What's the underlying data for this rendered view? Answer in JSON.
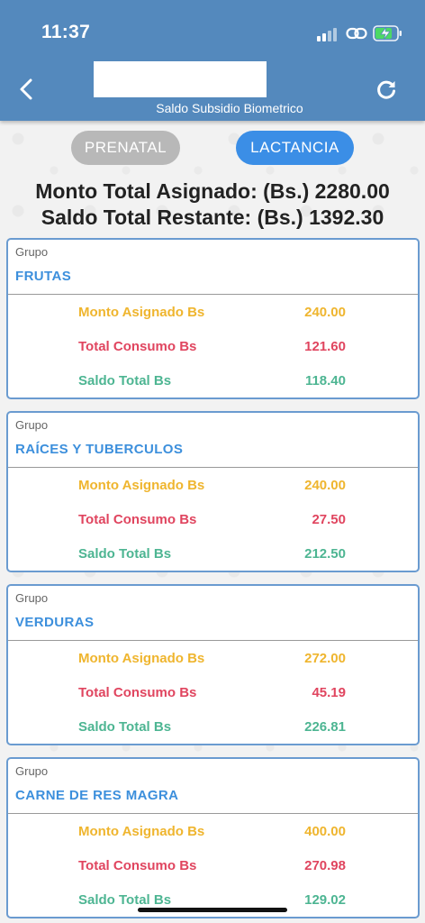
{
  "status_bar": {
    "time": "11:37"
  },
  "header": {
    "subtitle": "Saldo Subsidio Biometrico"
  },
  "tabs": [
    {
      "label": "PRENATAL",
      "active": false
    },
    {
      "label": "LACTANCIA",
      "active": true
    }
  ],
  "totals": {
    "assigned": "Monto Total Asignado: (Bs.) 2280.00",
    "remaining": "Saldo Total Restante: (Bs.) 1392.30"
  },
  "colors": {
    "header": "#5489bd",
    "tab_active": "#3b8ee6",
    "tab_inactive": "#b8b8b8",
    "title_blue": "#3c8fdc",
    "asignado": "#efb52e",
    "consumo": "#e0455f",
    "saldo": "#4db592"
  },
  "cards": [
    {
      "group_label": "Grupo",
      "title": "FRUTAS",
      "rows": [
        {
          "label": "Monto Asignado Bs",
          "value": "240.00"
        },
        {
          "label": "Total Consumo Bs",
          "value": "121.60"
        },
        {
          "label": "Saldo Total Bs",
          "value": "118.40"
        }
      ]
    },
    {
      "group_label": "Grupo",
      "title": "RAÍCES Y TUBERCULOS",
      "rows": [
        {
          "label": "Monto Asignado Bs",
          "value": "240.00"
        },
        {
          "label": "Total Consumo Bs",
          "value": "27.50"
        },
        {
          "label": "Saldo Total Bs",
          "value": "212.50"
        }
      ]
    },
    {
      "group_label": "Grupo",
      "title": "VERDURAS",
      "rows": [
        {
          "label": "Monto Asignado Bs",
          "value": "272.00"
        },
        {
          "label": "Total Consumo Bs",
          "value": "45.19"
        },
        {
          "label": "Saldo Total Bs",
          "value": "226.81"
        }
      ]
    },
    {
      "group_label": "Grupo",
      "title": "CARNE DE RES MAGRA",
      "rows": [
        {
          "label": "Monto Asignado Bs",
          "value": "400.00"
        },
        {
          "label": "Total Consumo Bs",
          "value": "270.98"
        },
        {
          "label": "Saldo Total Bs",
          "value": "129.02"
        }
      ]
    }
  ],
  "icons": {
    "back": "chevron-left-icon",
    "refresh": "refresh-icon",
    "signal": "signal-icon",
    "link": "link-icon",
    "battery": "battery-charging-icon"
  }
}
